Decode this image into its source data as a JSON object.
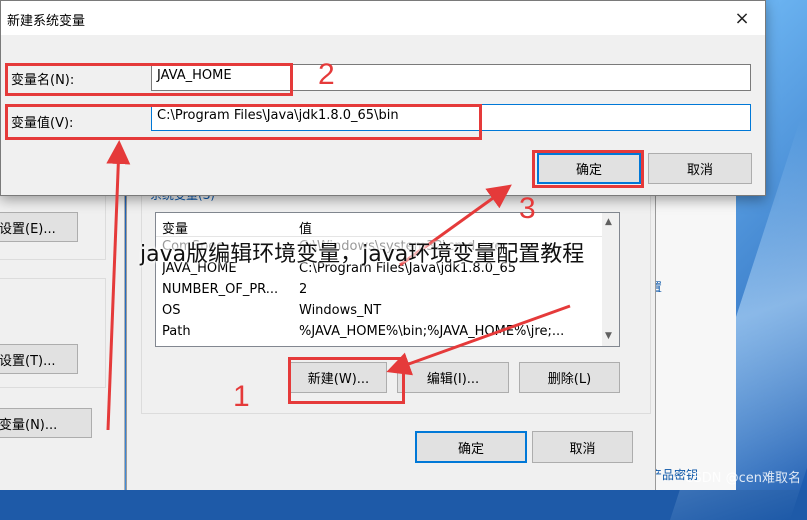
{
  "new_var_dialog": {
    "title": "新建系统变量",
    "close_icon": "×",
    "name_label": "变量名(N):",
    "name_value": "JAVA_HOME",
    "value_label": "变量值(V):",
    "value_value": "C:\\Program Files\\Java\\jdk1.8.0_65\\bin",
    "ok": "确定",
    "cancel": "取消"
  },
  "env_dialog": {
    "group_caption": "系统变量(S)",
    "columns": [
      "变量",
      "值"
    ],
    "rows": [
      {
        "name": "ComSpec",
        "value": "C:\\Windows\\system32\\cmd.exe"
      },
      {
        "name": "JAVA_HOME",
        "value": "C:\\Program Files\\Java\\jdk1.8.0_65"
      },
      {
        "name": "NUMBER_OF_PR...",
        "value": "2"
      },
      {
        "name": "OS",
        "value": "Windows_NT"
      },
      {
        "name": "Path",
        "value": "%JAVA_HOME%\\bin;%JAVA_HOME%\\jre;..."
      }
    ],
    "new_btn": "新建(W)...",
    "edit_btn": "编辑(I)...",
    "delete_btn": "删除(L)",
    "ok": "确定",
    "cancel": "取消"
  },
  "sys_props": {
    "btn1": "设置(E)...",
    "btn2": "设置(T)...",
    "btn3": "变量(N)..."
  },
  "right_panel": {
    "link1": "置",
    "link2": "产品密钥"
  },
  "annotations": {
    "n1": "1",
    "n2": "2",
    "n3": "3",
    "overlay_title": "java版编辑环境变量，java环境变量配置教程",
    "watermark": "CSDN @cen难取名"
  },
  "colors": {
    "annotation": "#e53a3a",
    "accent": "#0078d7"
  }
}
